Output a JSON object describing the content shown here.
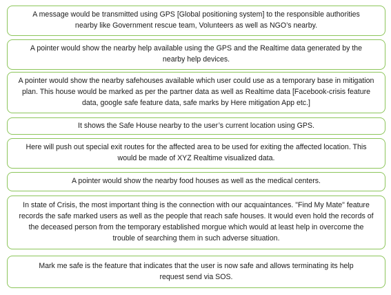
{
  "border_color": "#8cc55a",
  "text_color": "#1a1a1a",
  "boxes": [
    {
      "text": "A message would be transmitted using GPS [Global positioning system] to the responsible authorities nearby like Government rescue team, Volunteers as well as NGO’s nearby."
    },
    {
      "text": "A pointer would show the nearby help available using the GPS and the Realtime data generated by the nearby help devices."
    },
    {
      "text": "A pointer would show the nearby safehouses available which user could use as a temporary base in mitigation plan. This house would be marked as per the partner data as well as Realtime data [Facebook-crisis feature data, google safe feature data, safe marks by Here mitigation App etc.]"
    },
    {
      "text": "It shows the Safe House nearby to the user’s current location using GPS."
    },
    {
      "text": "Here will push out special exit routes for the affected area to be used for exiting the affected location. This would be made of XYZ Realtime visualized data."
    },
    {
      "text": "A pointer would show the nearby food houses as well as the medical centers."
    },
    {
      "text": "In state of Crisis, the most important thing is the connection with our acquaintances. \"Find My Mate\" feature records the safe marked users as well as the people that reach safe houses. It would even hold the records of the deceased person from the temporary established morgue which would at least help in overcome the trouble of searching them in such adverse situation."
    },
    {
      "text": "Mark me safe is the feature that indicates that the user is now safe and allows terminating its help request send via SOS."
    }
  ]
}
